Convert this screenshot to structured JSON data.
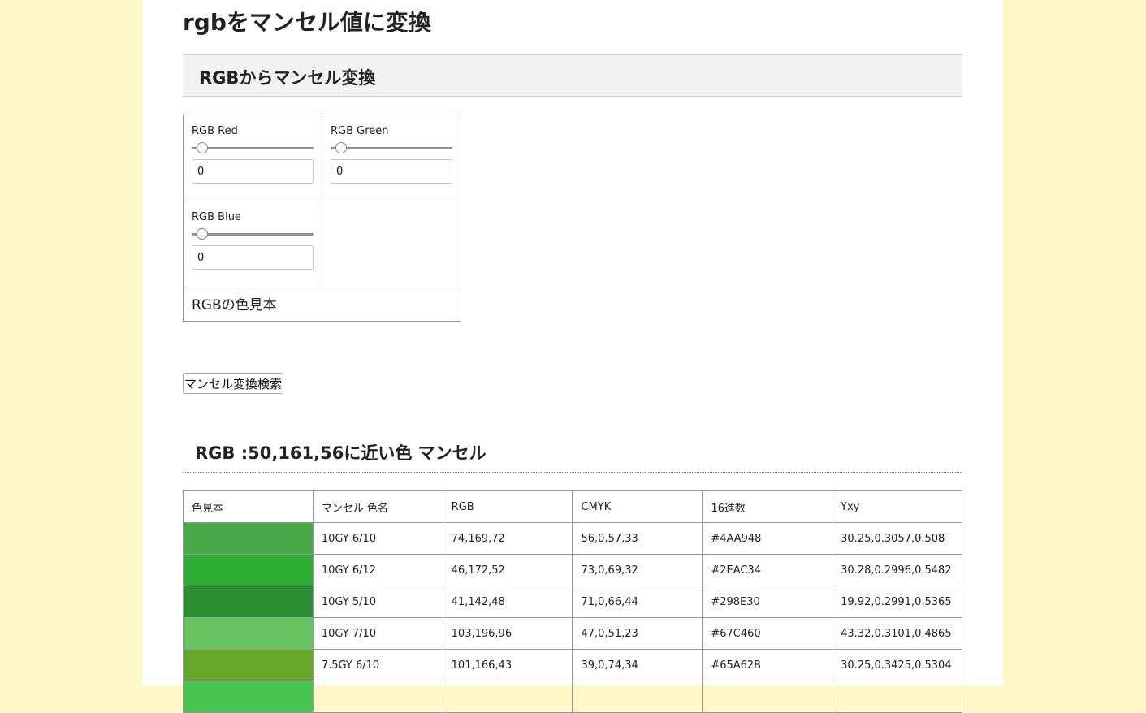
{
  "page": {
    "title": "rgbをマンセル値に変換"
  },
  "converter": {
    "section_title": "RGBからマンセル変換",
    "red": {
      "label": "RGB Red",
      "value": "0"
    },
    "green": {
      "label": "RGB Green",
      "value": "0"
    },
    "blue": {
      "label": "RGB Blue",
      "value": "0"
    },
    "swatch_label": "RGBの色見本",
    "search_button": "マンセル変換検索"
  },
  "results": {
    "heading": "RGB :50,161,56に近い色 マンセル",
    "columns": [
      "色見本",
      "マンセル 色名",
      "RGB",
      "CMYK",
      "16進数",
      "Yxy"
    ],
    "rows": [
      {
        "color": "#4AA948",
        "munsell": "10GY 6/10",
        "rgb": "74,169,72",
        "cmyk": "56,0,57,33",
        "hex": "#4AA948",
        "yxy": "30.25,0.3057,0.508"
      },
      {
        "color": "#2EAC34",
        "munsell": "10GY 6/12",
        "rgb": "46,172,52",
        "cmyk": "73,0,69,32",
        "hex": "#2EAC34",
        "yxy": "30.28,0.2996,0.5482"
      },
      {
        "color": "#298E30",
        "munsell": "10GY 5/10",
        "rgb": "41,142,48",
        "cmyk": "71,0,66,44",
        "hex": "#298E30",
        "yxy": "19.92,0.2991,0.5365"
      },
      {
        "color": "#67C460",
        "munsell": "10GY 7/10",
        "rgb": "103,196,96",
        "cmyk": "47,0,51,23",
        "hex": "#67C460",
        "yxy": "43.32,0.3101,0.4865"
      },
      {
        "color": "#65A62B",
        "munsell": "7.5GY 6/10",
        "rgb": "101,166,43",
        "cmyk": "39,0,74,34",
        "hex": "#65A62B",
        "yxy": "30.25,0.3425,0.5304"
      },
      {
        "color": "#47C44F",
        "munsell": "",
        "rgb": "",
        "cmyk": "",
        "hex": "",
        "yxy": ""
      }
    ]
  }
}
